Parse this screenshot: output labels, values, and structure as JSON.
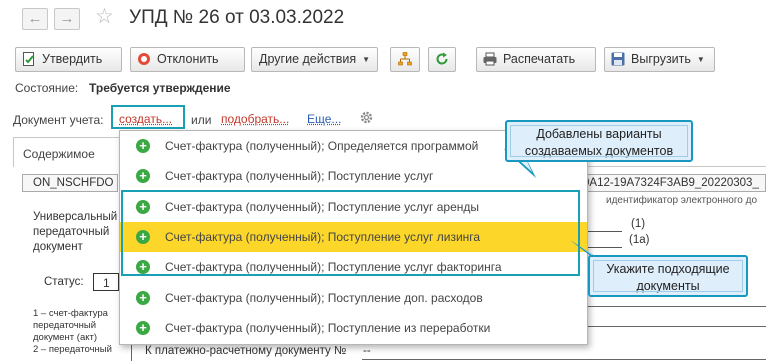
{
  "header": {
    "back_icon": "arrow-left-icon",
    "forward_icon": "arrow-right-icon",
    "favorite_icon": "star-icon",
    "title": "УПД № 26 от 03.03.2022"
  },
  "toolbar": {
    "approve": "Утвердить",
    "reject": "Отклонить",
    "other_actions": "Другие действия",
    "print": "Распечатать",
    "upload": "Выгрузить"
  },
  "status": {
    "label": "Состояние:",
    "value": "Требуется утверждение"
  },
  "document": {
    "label": "Документ учета:",
    "create": "создать...",
    "or": "или",
    "pick": "подобрать...",
    "more": "Еще..."
  },
  "tabs": {
    "contents": "Содержимое"
  },
  "background": {
    "file_id_left": "ON_NSCHFDO",
    "file_id_right": "0A12-19A7324F3AB9_20220303_",
    "doc_id_caption": "идентификатор электронного до",
    "doc_type_line1": "Универсальный",
    "doc_type_line2": "передаточный",
    "doc_type_line3": "документ",
    "mark_1": "(1)",
    "mark_1a": "(1а)",
    "status_label": "Статус:",
    "status_value": "1",
    "note_line1": "1 – счет-фактура",
    "note_line2": "передаточный",
    "note_line3": "документ (акт)",
    "note_line4": "2 – передаточный",
    "payment_doc": "К платежно-расчетному документу №",
    "payment_value": "--"
  },
  "menu": {
    "items": [
      "Счет-фактура (полученный); Определяется программой",
      "Счет-фактура (полученный); Поступление услуг",
      "Счет-фактура (полученный); Поступление услуг аренды",
      "Счет-фактура (полученный); Поступление услуг лизинга",
      "Счет-фактура (полученный); Поступление услуг факторинга",
      "Счет-фактура (полученный); Поступление доп. расходов",
      "Счет-фактура (полученный); Поступление из переработки"
    ],
    "selected_index": 3
  },
  "callouts": {
    "top_line1": "Добавлены варианты",
    "top_line2": "создаваемых  документов",
    "bottom_line1": "Укажите подходящие",
    "bottom_line2": "документы"
  },
  "colors": {
    "link_red": "#c0392b",
    "link_blue": "#2b5fb3",
    "highlight": "#fcd72a",
    "accent_teal": "#1aa0b4",
    "plus_green": "#3aa843"
  }
}
